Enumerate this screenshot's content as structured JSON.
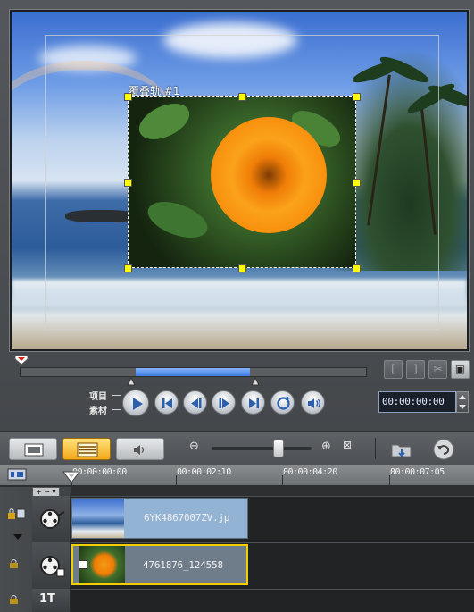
{
  "preview": {
    "overlay_label": "覆叠轨 #1"
  },
  "playback": {
    "project_label": "项目",
    "clip_label": "素材",
    "timecode": "00:00:00:00"
  },
  "edit_buttons": {
    "mark_in": "[",
    "mark_out": "]",
    "cut": "✂",
    "enlarge": "▣"
  },
  "ruler": {
    "ticks": [
      "00:00:00:00",
      "00:00:02:10",
      "00:00:04:20",
      "00:00:07:05"
    ]
  },
  "tracks": {
    "video_clip_name": "6YK4867007ZV.jp",
    "overlay_clip_name": "4761876_124558",
    "title_track_label": "1T",
    "track_controls": "+ − ▾"
  },
  "colors": {
    "accent_blue": "#3f7de0",
    "handle_yellow": "#ffff00",
    "active_view": "#f2a81a"
  }
}
